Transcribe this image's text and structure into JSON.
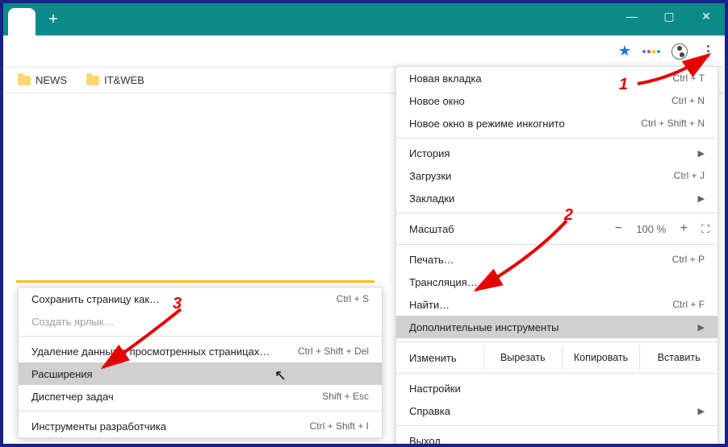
{
  "titlebar": {
    "newtab": "+"
  },
  "window_controls": {
    "min": "—",
    "max": "▢",
    "close": "✕"
  },
  "bookmarks": [
    {
      "label": "NEWS"
    },
    {
      "label": "IT&WEB"
    }
  ],
  "toolbar": {
    "star": "★"
  },
  "main_menu": {
    "new_tab": {
      "label": "Новая вкладка",
      "shortcut": "Ctrl + T"
    },
    "new_window": {
      "label": "Новое окно",
      "shortcut": "Ctrl + N"
    },
    "incognito": {
      "label": "Новое окно в режиме инкогнито",
      "shortcut": "Ctrl + Shift + N"
    },
    "history": {
      "label": "История",
      "arrow": "▶"
    },
    "downloads": {
      "label": "Загрузки",
      "shortcut": "Ctrl + J"
    },
    "bookmarks": {
      "label": "Закладки",
      "arrow": "▶"
    },
    "zoom": {
      "label": "Масштаб",
      "minus": "−",
      "value": "100 %",
      "plus": "+",
      "full": "⛶"
    },
    "print": {
      "label": "Печать…",
      "shortcut": "Ctrl + P"
    },
    "cast": {
      "label": "Трансляция…"
    },
    "find": {
      "label": "Найти…",
      "shortcut": "Ctrl + F"
    },
    "more_tools": {
      "label": "Дополнительные инструменты",
      "arrow": "▶"
    },
    "edit": {
      "label": "Изменить",
      "cut": "Вырезать",
      "copy": "Копировать",
      "paste": "Вставить"
    },
    "settings": {
      "label": "Настройки"
    },
    "help": {
      "label": "Справка",
      "arrow": "▶"
    },
    "exit": {
      "label": "Выход"
    }
  },
  "submenu": {
    "save_page": {
      "label": "Сохранить страницу как…",
      "shortcut": "Ctrl + S"
    },
    "create_link": {
      "label": "Создать ярлык…"
    },
    "clear_data": {
      "label": "Удаление данных о просмотренных страницах…",
      "shortcut": "Ctrl + Shift + Del"
    },
    "extensions": {
      "label": "Расширения"
    },
    "task_mgr": {
      "label": "Диспетчер задач",
      "shortcut": "Shift + Esc"
    },
    "dev_tools": {
      "label": "Инструменты разработчика",
      "shortcut": "Ctrl + Shift + I"
    }
  },
  "annotations": {
    "n1": "1",
    "n2": "2",
    "n3": "3"
  }
}
